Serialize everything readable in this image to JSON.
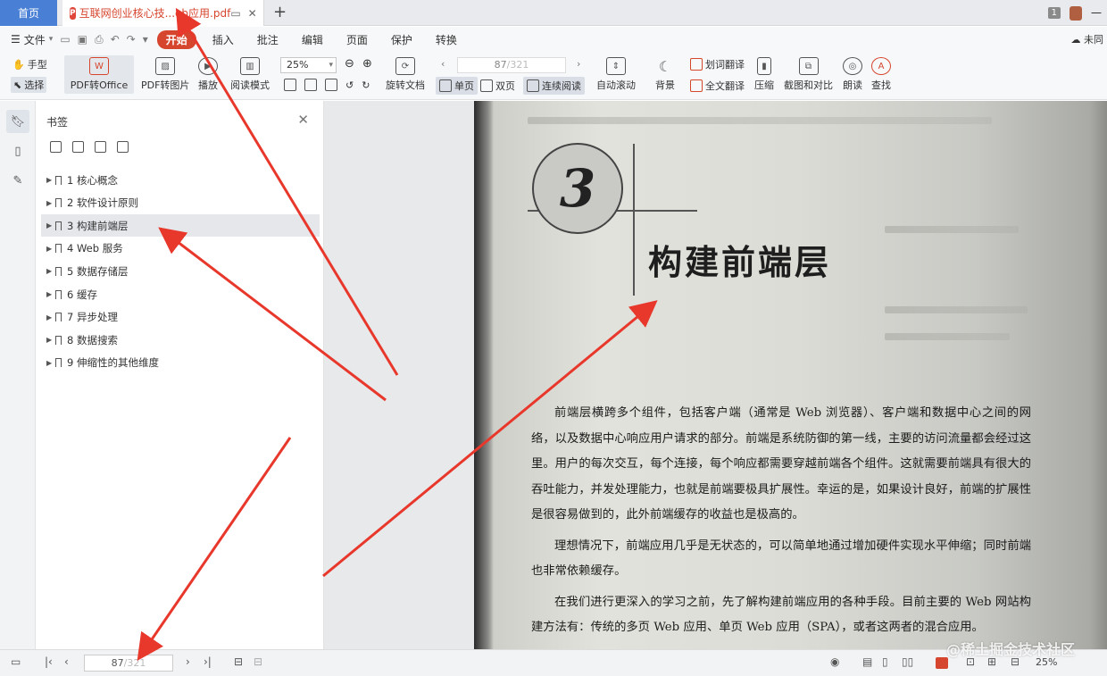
{
  "tabs": {
    "home_label": "首页",
    "doc_badge": "P",
    "doc_title": "互联网创业核心技...eb应用.pdf",
    "add_icon": "plus-icon",
    "page_badge": "1",
    "more_label": "一"
  },
  "menu": {
    "file_label": "文件",
    "items": [
      "开始",
      "插入",
      "批注",
      "编辑",
      "页面",
      "保护",
      "转换"
    ],
    "active_item": "开始",
    "cloud_label": "未同"
  },
  "toolbar": {
    "hand_label": "手型",
    "select_label": "选择",
    "pdf_office_label": "PDF转Office",
    "pdf_image_label": "PDF转图片",
    "play_label": "播放",
    "read_mode_label": "阅读模式",
    "zoom_value": "25%",
    "rotate_label": "旋转文档",
    "page_current": "87",
    "page_total": "/321",
    "single_label": "单页",
    "double_label": "双页",
    "continuous_label": "连续阅读",
    "autoscroll_label": "自动滚动",
    "background_label": "背景",
    "word_translate_label": "划词翻译",
    "full_translate_label": "全文翻译",
    "compress_label": "压缩",
    "screenshot_label": "截图和对比",
    "read_aloud_label": "朗读",
    "find_label": "查找"
  },
  "bookmarks": {
    "title": "书签",
    "items": [
      {
        "label": "1 核心概念"
      },
      {
        "label": "2 软件设计原则"
      },
      {
        "label": "3 构建前端层"
      },
      {
        "label": "4 Web 服务"
      },
      {
        "label": "5 数据存储层"
      },
      {
        "label": "6 缓存"
      },
      {
        "label": "7 异步处理"
      },
      {
        "label": "8 数据搜索"
      },
      {
        "label": "9 伸缩性的其他维度"
      }
    ],
    "selected_index": 2
  },
  "document": {
    "chapter_number": "3",
    "chapter_title": "构建前端层",
    "paragraphs": [
      "前端层横跨多个组件，包括客户端（通常是 Web 浏览器）、客户端和数据中心之间的网络，以及数据中心响应用户请求的部分。前端是系统防御的第一线，主要的访问流量都会经过这里。用户的每次交互，每个连接，每个响应都需要穿越前端各个组件。这就需要前端具有很大的吞吐能力，并发处理能力，也就是前端要极具扩展性。幸运的是，如果设计良好，前端的扩展性是很容易做到的，此外前端缓存的收益也是极高的。",
      "理想情况下，前端应用几乎是无状态的，可以简单地通过增加硬件实现水平伸缩；同时前端也非常依赖缓存。",
      "在我们进行更深入的学习之前，先了解构建前端应用的各种手段。目前主要的 Web 网站构建方法有：传统的多页 Web 应用、单页 Web 应用（SPA），或者这两者的混合应用。"
    ]
  },
  "statusbar": {
    "page_current": "87",
    "page_total": "/321",
    "zoom_value": "25%",
    "watermark": "@稀土掘金技术社区"
  },
  "colors": {
    "accent": "#d6452d",
    "home_tab": "#4a7fd6",
    "arrow": "#e8382c"
  }
}
